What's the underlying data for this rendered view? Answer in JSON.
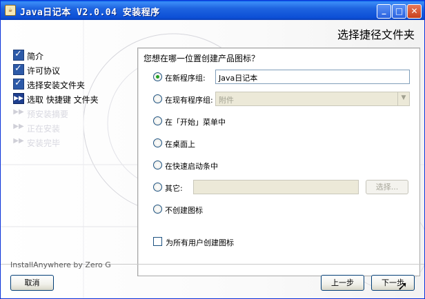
{
  "window": {
    "title": "Java日记本 V2.0.04 安装程序",
    "controls": {
      "minimize": "_",
      "maximize": "□",
      "close": "✕"
    }
  },
  "page": {
    "heading": "选择捷径文件夹",
    "question": "您想在哪一位置创建产品图标？"
  },
  "steps": [
    {
      "label": "简介",
      "state": "done"
    },
    {
      "label": "许可协议",
      "state": "done"
    },
    {
      "label": "选择安装文件夹",
      "state": "done"
    },
    {
      "label": "选取 快捷键 文件夹",
      "state": "current"
    },
    {
      "label": "预安装摘要",
      "state": "pending"
    },
    {
      "label": "正在安装",
      "state": "pending"
    },
    {
      "label": "安装完毕",
      "state": "pending"
    }
  ],
  "options": [
    {
      "label": "在新程序组:",
      "checked": true
    },
    {
      "label": "在现有程序组:",
      "checked": false
    },
    {
      "label": "在「开始」菜单中",
      "checked": false
    },
    {
      "label": "在桌面上",
      "checked": false
    },
    {
      "label": "在快速启动条中",
      "checked": false
    },
    {
      "label": "其它:",
      "checked": false
    },
    {
      "label": "不创建图标",
      "checked": false
    }
  ],
  "fields": {
    "new_group_value": "Java日记本",
    "existing_group_value": "附件",
    "other_value": "",
    "browse_label": "选择..."
  },
  "all_users_checkbox": {
    "label": "为所有用户创建图标",
    "checked": false
  },
  "footer": {
    "brand": "InstallAnywhere by Zero G",
    "cancel": "取消",
    "back": "上一步",
    "next": "下一步"
  }
}
